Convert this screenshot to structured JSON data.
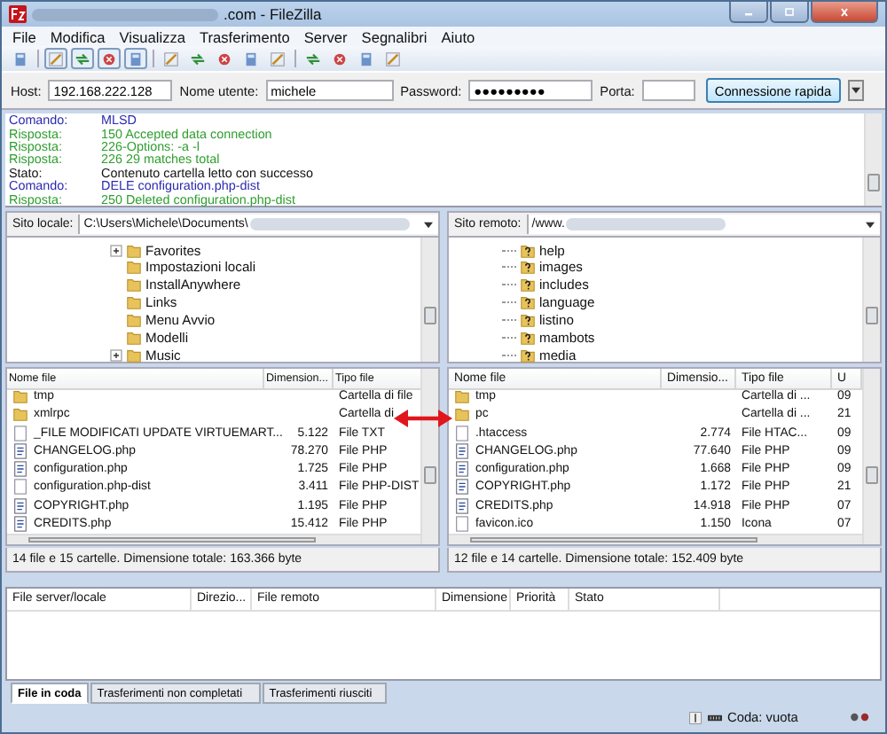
{
  "window": {
    "title": ".com - FileZilla"
  },
  "menu": [
    "File",
    "Modifica",
    "Visualizza",
    "Trasferimento",
    "Server",
    "Segnalibri",
    "Aiuto"
  ],
  "toolbar": [
    {
      "pressed": false
    },
    {
      "pressed": true
    },
    {
      "pressed": true
    },
    {
      "pressed": true
    },
    {
      "pressed": true
    },
    {
      "pressed": false
    },
    {
      "pressed": false
    },
    {
      "pressed": false
    },
    {
      "pressed": false
    },
    {
      "pressed": false
    },
    {
      "pressed": false
    },
    {
      "pressed": false
    },
    {
      "pressed": false
    },
    {
      "pressed": false
    }
  ],
  "quickconnect": {
    "host_label": "Host:",
    "host": "192.168.222.128",
    "user_label": "Nome utente:",
    "user": "michele",
    "password_label": "Password:",
    "password": "●●●●●●●●●",
    "port_label": "Porta:",
    "button": "Connessione rapida"
  },
  "log": [
    {
      "kind": "command",
      "label": "Comando:",
      "text": "MLSD"
    },
    {
      "kind": "response",
      "label": "Risposta:",
      "text": "150 Accepted data connection"
    },
    {
      "kind": "response",
      "label": "Risposta:",
      "text": "226-Options: -a -l"
    },
    {
      "kind": "response",
      "label": "Risposta:",
      "text": "226 29 matches total"
    },
    {
      "kind": "status",
      "label": "Stato:",
      "text": "Contenuto cartella letto con successo"
    },
    {
      "kind": "command",
      "label": "Comando:",
      "text": "DELE configuration.php-dist"
    },
    {
      "kind": "response",
      "label": "Risposta:",
      "text": "250 Deleted configuration.php-dist"
    }
  ],
  "local": {
    "site_label": "Sito locale:",
    "path": "C:\\Users\\Michele\\Documents\\",
    "tree": [
      {
        "name": "Favorites",
        "expandable": true
      },
      {
        "name": "Impostazioni locali",
        "expandable": false
      },
      {
        "name": "InstallAnywhere",
        "expandable": false
      },
      {
        "name": "Links",
        "expandable": false
      },
      {
        "name": "Menu Avvio",
        "expandable": false
      },
      {
        "name": "Modelli",
        "expandable": false
      },
      {
        "name": "Music",
        "expandable": true
      }
    ],
    "columns": [
      "Nome file",
      "Dimension...",
      "Tipo file"
    ],
    "rows": [
      {
        "kind": "folder",
        "name": "tmp",
        "size": "",
        "filetype": "Cartella di file"
      },
      {
        "kind": "folder",
        "name": "xmlrpc",
        "size": "",
        "filetype": "Cartella di"
      },
      {
        "kind": "file",
        "name": "_FILE MODIFICATI UPDATE VIRTUEMART...",
        "size": "5.122",
        "filetype": "File TXT"
      },
      {
        "kind": "php",
        "name": "CHANGELOG.php",
        "size": "78.270",
        "filetype": "File PHP"
      },
      {
        "kind": "php",
        "name": "configuration.php",
        "size": "1.725",
        "filetype": "File PHP"
      },
      {
        "kind": "file",
        "name": "configuration.php-dist",
        "size": "3.411",
        "filetype": "File PHP-DIST"
      },
      {
        "kind": "php",
        "name": "COPYRIGHT.php",
        "size": "1.195",
        "filetype": "File PHP"
      },
      {
        "kind": "php",
        "name": "CREDITS.php",
        "size": "15.412",
        "filetype": "File PHP"
      }
    ],
    "status": "14 file e 15 cartelle. Dimensione totale: 163.366 byte"
  },
  "remote": {
    "site_label": "Sito remoto:",
    "path": "/www.",
    "tree": [
      {
        "name": "help"
      },
      {
        "name": "images"
      },
      {
        "name": "includes"
      },
      {
        "name": "language"
      },
      {
        "name": "listino"
      },
      {
        "name": "mambots"
      },
      {
        "name": "media"
      }
    ],
    "columns": [
      "Nome file",
      "Dimensio...",
      "Tipo file",
      "U"
    ],
    "rows": [
      {
        "kind": "folder",
        "name": "tmp",
        "size": "",
        "filetype": "Cartella di ...",
        "column_4": "09"
      },
      {
        "kind": "folder",
        "name": "pc",
        "size": "",
        "filetype": "Cartella di ...",
        "column_4": "21"
      },
      {
        "kind": "file",
        "name": ".htaccess",
        "size": "2.774",
        "filetype": "File HTAC...",
        "column_4": "09"
      },
      {
        "kind": "php",
        "name": "CHANGELOG.php",
        "size": "77.640",
        "filetype": "File PHP",
        "column_4": "09"
      },
      {
        "kind": "php",
        "name": "configuration.php",
        "size": "1.668",
        "filetype": "File PHP",
        "column_4": "09"
      },
      {
        "kind": "php",
        "name": "COPYRIGHT.php",
        "size": "1.172",
        "filetype": "File PHP",
        "column_4": "21"
      },
      {
        "kind": "php",
        "name": "CREDITS.php",
        "size": "14.918",
        "filetype": "File PHP",
        "column_4": "07"
      },
      {
        "kind": "file",
        "name": "favicon.ico",
        "size": "1.150",
        "filetype": "Icona",
        "column_4": "07"
      }
    ],
    "status": "12 file e 14 cartelle. Dimensione totale: 152.409 byte"
  },
  "queue": {
    "columns": [
      "File server/locale",
      "Direzio...",
      "File remoto",
      "Dimensione",
      "Priorità",
      "Stato"
    ]
  },
  "queue_tabs": [
    {
      "label": "File in coda",
      "selected": true
    },
    {
      "label": "Trasferimenti non completati",
      "selected": false
    },
    {
      "label": "Trasferimenti riusciti",
      "selected": false
    }
  ],
  "status_bar": {
    "queue": "Coda: vuota"
  }
}
